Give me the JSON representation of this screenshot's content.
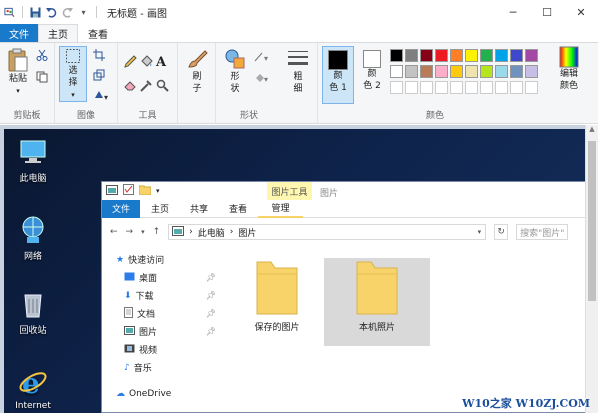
{
  "window": {
    "title": "无标题 - 画图"
  },
  "tabs": {
    "file": "文件",
    "home": "主页",
    "view": "查看"
  },
  "ribbon": {
    "clipboard": {
      "label": "剪贴板",
      "paste": "粘贴"
    },
    "image": {
      "label": "图像",
      "select_line1": "选",
      "select_line2": "择"
    },
    "tools": {
      "label": "工具"
    },
    "brush": {
      "line1": "刷",
      "line2": "子"
    },
    "shapes": {
      "label": "形状",
      "shape_line1": "形",
      "shape_line2": "状",
      "outline_line1": "粗",
      "outline_line2": "细"
    },
    "colors": {
      "label": "颜色",
      "color1_a": "颜",
      "color1_b": "色 1",
      "color2_a": "颜",
      "color2_b": "色 2",
      "edit_a": "编辑",
      "edit_b": "颜色"
    }
  },
  "palette": [
    "#000000",
    "#7f7f7f",
    "#880015",
    "#ed1c24",
    "#ff7f27",
    "#fff200",
    "#22b14c",
    "#00a2e8",
    "#3f48cc",
    "#a349a4",
    "#ffffff",
    "#c3c3c3",
    "#b97a57",
    "#ffaec9",
    "#ffc90e",
    "#efe4b0",
    "#b5e61d",
    "#99d9ea",
    "#7092be",
    "#c8bfe7"
  ],
  "desktop": {
    "icons": [
      {
        "label": "此电脑"
      },
      {
        "label": "网络"
      },
      {
        "label": "回收站"
      },
      {
        "label": "Internet"
      }
    ]
  },
  "explorer": {
    "tabs": {
      "context_group": "图片工具",
      "title": "图片",
      "file": "文件",
      "home": "主页",
      "share": "共享",
      "view": "查看",
      "manage": "管理"
    },
    "breadcrumb": {
      "root": "此电脑",
      "sep": "›",
      "current": "图片"
    },
    "search_placeholder": "搜索\"图片\"",
    "nav": [
      {
        "label": "快速访问"
      },
      {
        "label": "桌面"
      },
      {
        "label": "下载"
      },
      {
        "label": "文档"
      },
      {
        "label": "图片"
      },
      {
        "label": "视频"
      },
      {
        "label": "音乐"
      },
      {
        "label": "OneDrive"
      }
    ],
    "folders": [
      {
        "label": "保存的图片"
      },
      {
        "label": "本机照片"
      }
    ]
  },
  "watermark": "W10之家 W10ZJ.COM"
}
